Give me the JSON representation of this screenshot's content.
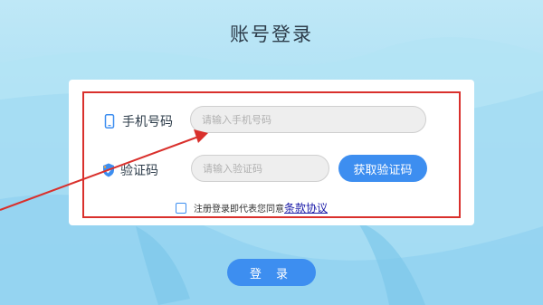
{
  "page": {
    "title": "账号登录"
  },
  "form": {
    "phone_label": "手机号码",
    "phone_placeholder": "请输入手机号码",
    "phone_icon": "phone-icon",
    "code_label": "验证码",
    "code_placeholder": "请输入验证码",
    "code_icon": "shield-check-icon",
    "get_code_label": "获取验证码"
  },
  "agreement": {
    "text": "注册登录即代表您同意",
    "link": "条款协议",
    "checked": false
  },
  "login_label": "登 录",
  "colors": {
    "accent": "#3d8ef0",
    "highlight": "#d9302c",
    "link": "#1a1aa8",
    "background": "#a9def3"
  }
}
